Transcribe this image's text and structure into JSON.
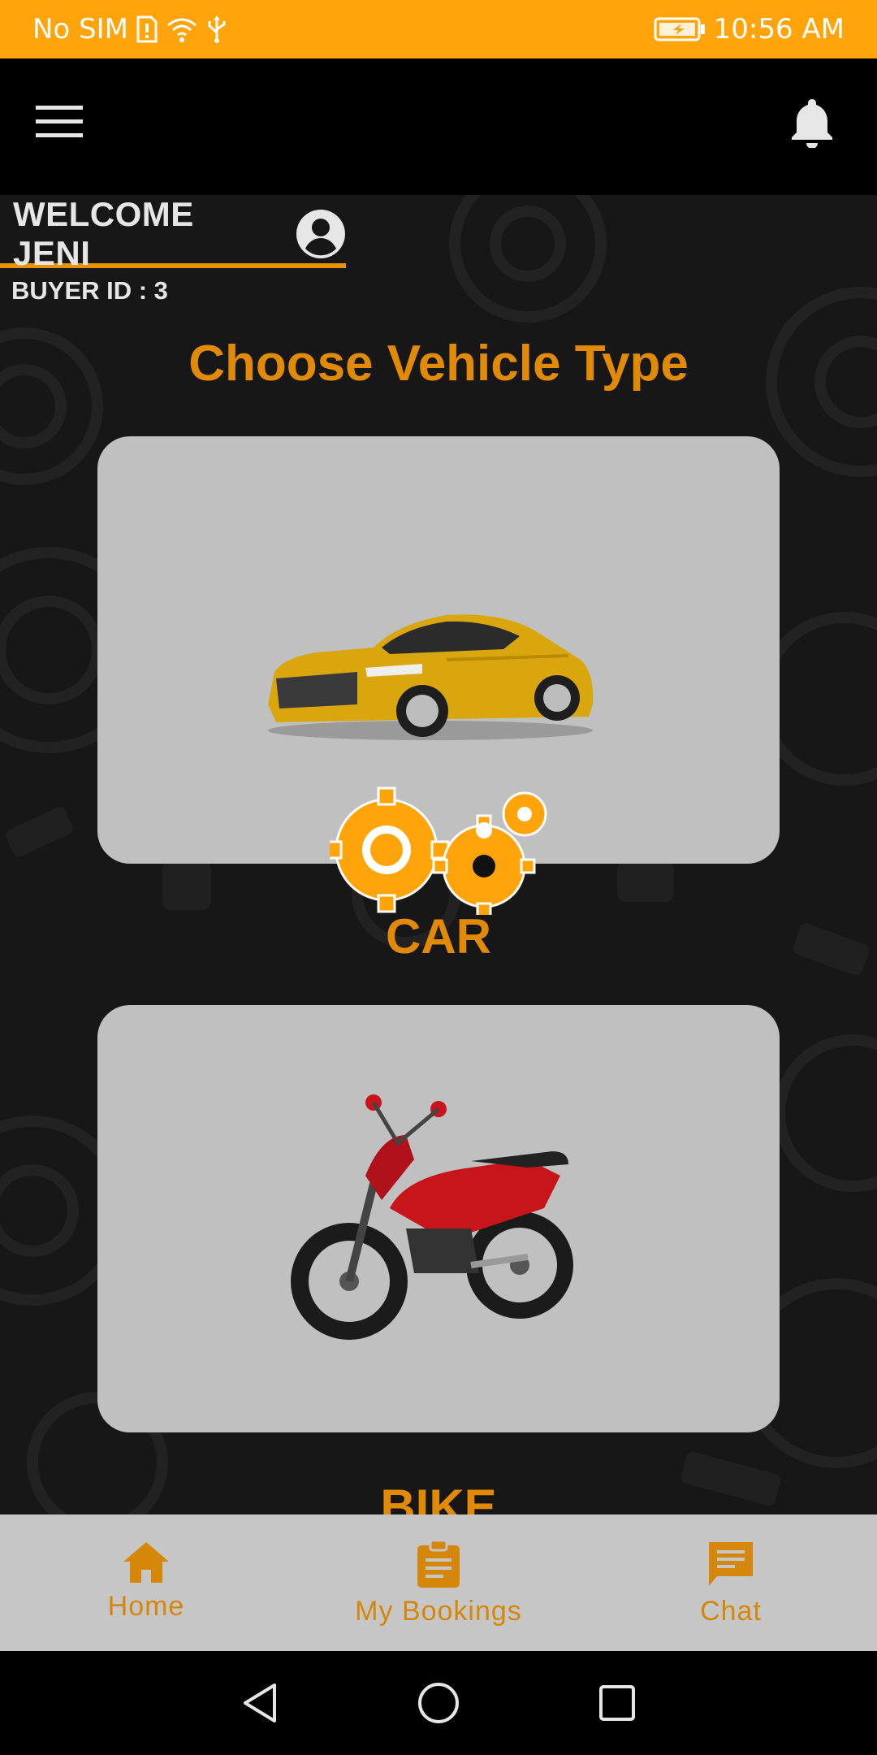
{
  "status_bar": {
    "carrier": "No SIM",
    "time": "10:56 AM"
  },
  "header": {
    "welcome": "WELCOME JENI",
    "buyer_id": "BUYER ID : 3"
  },
  "main": {
    "title": "Choose Vehicle Type",
    "options": [
      {
        "label": "CAR",
        "image": "car-image"
      },
      {
        "label": "BIKE",
        "image": "bike-image"
      }
    ]
  },
  "bottom_nav": {
    "items": [
      {
        "label": "Home",
        "icon": "home-icon"
      },
      {
        "label": "My Bookings",
        "icon": "clipboard-icon"
      },
      {
        "label": "Chat",
        "icon": "chat-icon"
      }
    ]
  },
  "colors": {
    "status_bar": "#ffa40a",
    "accent": "#e08a05",
    "card": "#c0c0c0",
    "nav_bg": "#c6c6c6"
  }
}
